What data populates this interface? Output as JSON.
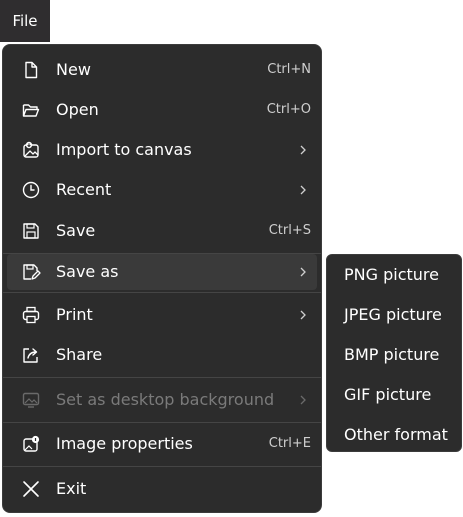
{
  "file_tab": {
    "label": "File"
  },
  "menu": {
    "items": [
      {
        "label": "New",
        "shortcut": "Ctrl+N",
        "icon": "new-file-icon"
      },
      {
        "label": "Open",
        "shortcut": "Ctrl+O",
        "icon": "folder-open-icon"
      },
      {
        "label": "Import to canvas",
        "icon": "import-icon",
        "submenu": true
      },
      {
        "label": "Recent",
        "icon": "clock-icon",
        "submenu": true
      },
      {
        "label": "Save",
        "shortcut": "Ctrl+S",
        "icon": "save-icon"
      },
      {
        "label": "Save as",
        "icon": "save-as-icon",
        "submenu": true,
        "active": true
      },
      {
        "label": "Print",
        "icon": "printer-icon",
        "submenu": true
      },
      {
        "label": "Share",
        "icon": "share-icon"
      },
      {
        "label": "Set as desktop background",
        "icon": "desktop-background-icon",
        "submenu": true,
        "disabled": true
      },
      {
        "label": "Image properties",
        "shortcut": "Ctrl+E",
        "icon": "image-properties-icon"
      },
      {
        "label": "Exit",
        "icon": "close-icon"
      }
    ]
  },
  "save_as_submenu": {
    "items": [
      {
        "label": "PNG picture"
      },
      {
        "label": "JPEG picture"
      },
      {
        "label": "BMP picture"
      },
      {
        "label": "GIF picture"
      },
      {
        "label": "Other format"
      }
    ]
  },
  "colors": {
    "menu_background": "#2c2c2c",
    "active_item": "#3a3a3a",
    "disabled_text": "#7a7a7a",
    "text": "#ffffff"
  }
}
